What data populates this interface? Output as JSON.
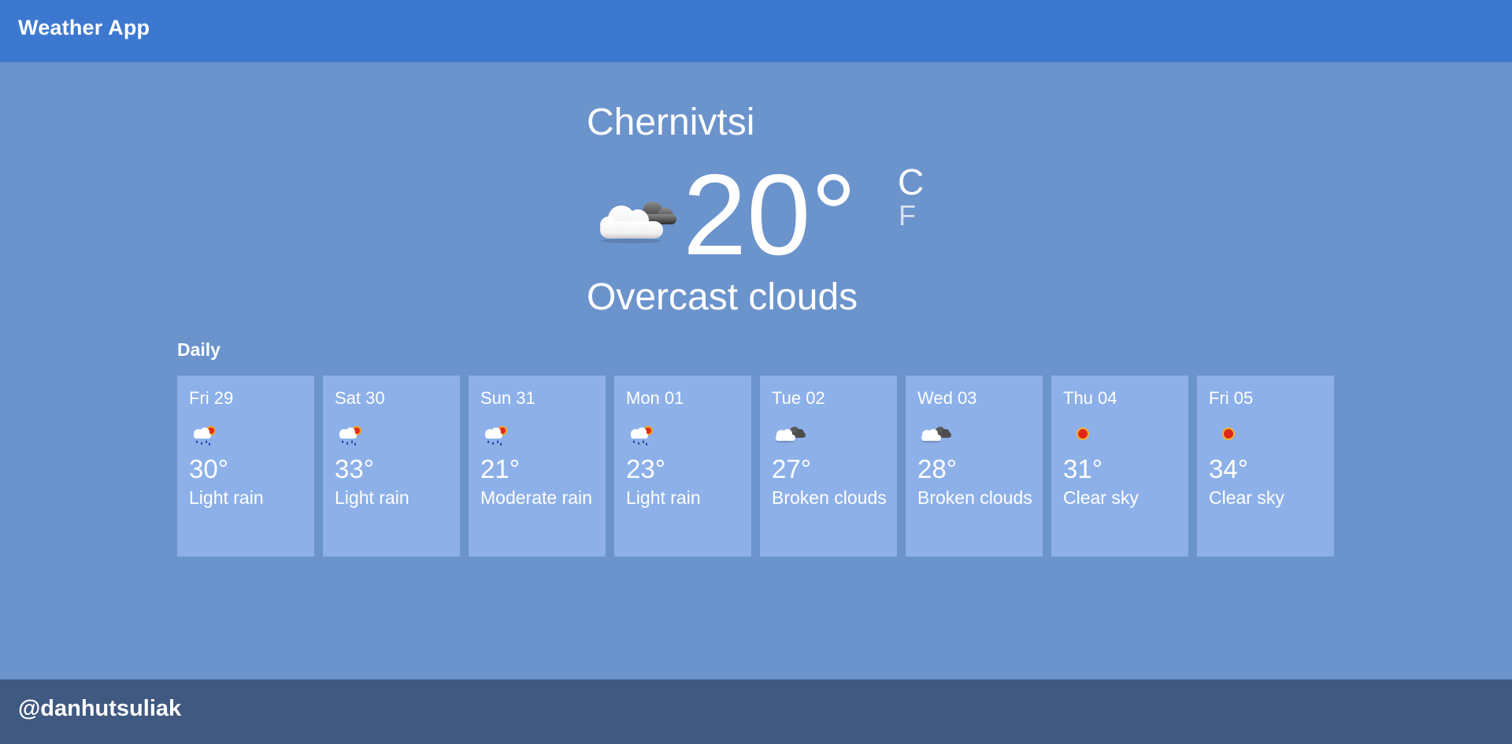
{
  "app": {
    "title": "Weather App"
  },
  "current": {
    "city": "Chernivtsi",
    "temperature": "20°",
    "unit_c": "C",
    "unit_f": "F",
    "condition": "Overcast clouds",
    "icon": "overcast-clouds-icon"
  },
  "daily": {
    "title": "Daily",
    "days": [
      {
        "day": "Fri 29",
        "temp": "30°",
        "desc": "Light rain",
        "icon": "light-rain-icon"
      },
      {
        "day": "Sat 30",
        "temp": "33°",
        "desc": "Light rain",
        "icon": "light-rain-icon"
      },
      {
        "day": "Sun 31",
        "temp": "21°",
        "desc": "Moderate rain",
        "icon": "light-rain-icon"
      },
      {
        "day": "Mon 01",
        "temp": "23°",
        "desc": "Light rain",
        "icon": "light-rain-icon"
      },
      {
        "day": "Tue 02",
        "temp": "27°",
        "desc": "Broken clouds",
        "icon": "broken-clouds-icon"
      },
      {
        "day": "Wed 03",
        "temp": "28°",
        "desc": "Broken clouds",
        "icon": "broken-clouds-icon"
      },
      {
        "day": "Thu 04",
        "temp": "31°",
        "desc": "Clear sky",
        "icon": "clear-sky-icon"
      },
      {
        "day": "Fri 05",
        "temp": "34°",
        "desc": "Clear sky",
        "icon": "clear-sky-icon"
      }
    ]
  },
  "footer": {
    "handle": "@danhutsuliak"
  },
  "colors": {
    "header": "#3d78d0",
    "background": "#6b93cc",
    "card": "#8db0e8",
    "footer": "#405980"
  }
}
